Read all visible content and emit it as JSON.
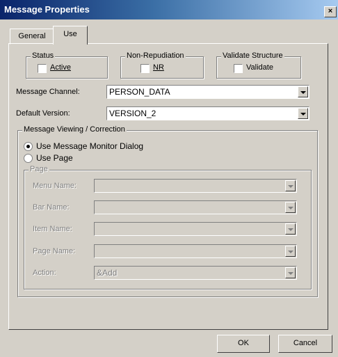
{
  "window": {
    "title": "Message Properties",
    "close_glyph": "×"
  },
  "tabs": [
    {
      "label": "General"
    },
    {
      "label": "Use"
    }
  ],
  "status": {
    "title": "Status",
    "checkbox_label": "Active",
    "checked": false
  },
  "non_repudiation": {
    "title": "Non-Repudiation",
    "checkbox_label": "NR",
    "checked": false
  },
  "validate_structure": {
    "title": "Validate Structure",
    "checkbox_label": "Validate",
    "checked": false
  },
  "message_channel": {
    "label": "Message Channel:",
    "value": "PERSON_DATA"
  },
  "default_version": {
    "label": "Default Version:",
    "value": "VERSION_2"
  },
  "viewing": {
    "title": "Message Viewing / Correction",
    "options": [
      {
        "label": "Use Message Monitor Dialog",
        "selected": true
      },
      {
        "label": "Use Page",
        "selected": false
      }
    ]
  },
  "page": {
    "title": "Page",
    "fields": [
      {
        "label": "Menu Name:",
        "value": ""
      },
      {
        "label": "Bar Name:",
        "value": ""
      },
      {
        "label": "Item Name:",
        "value": ""
      },
      {
        "label": "Page Name:",
        "value": ""
      },
      {
        "label": "Action:",
        "value": "&Add"
      }
    ]
  },
  "buttons": {
    "ok": "OK",
    "cancel": "Cancel"
  }
}
